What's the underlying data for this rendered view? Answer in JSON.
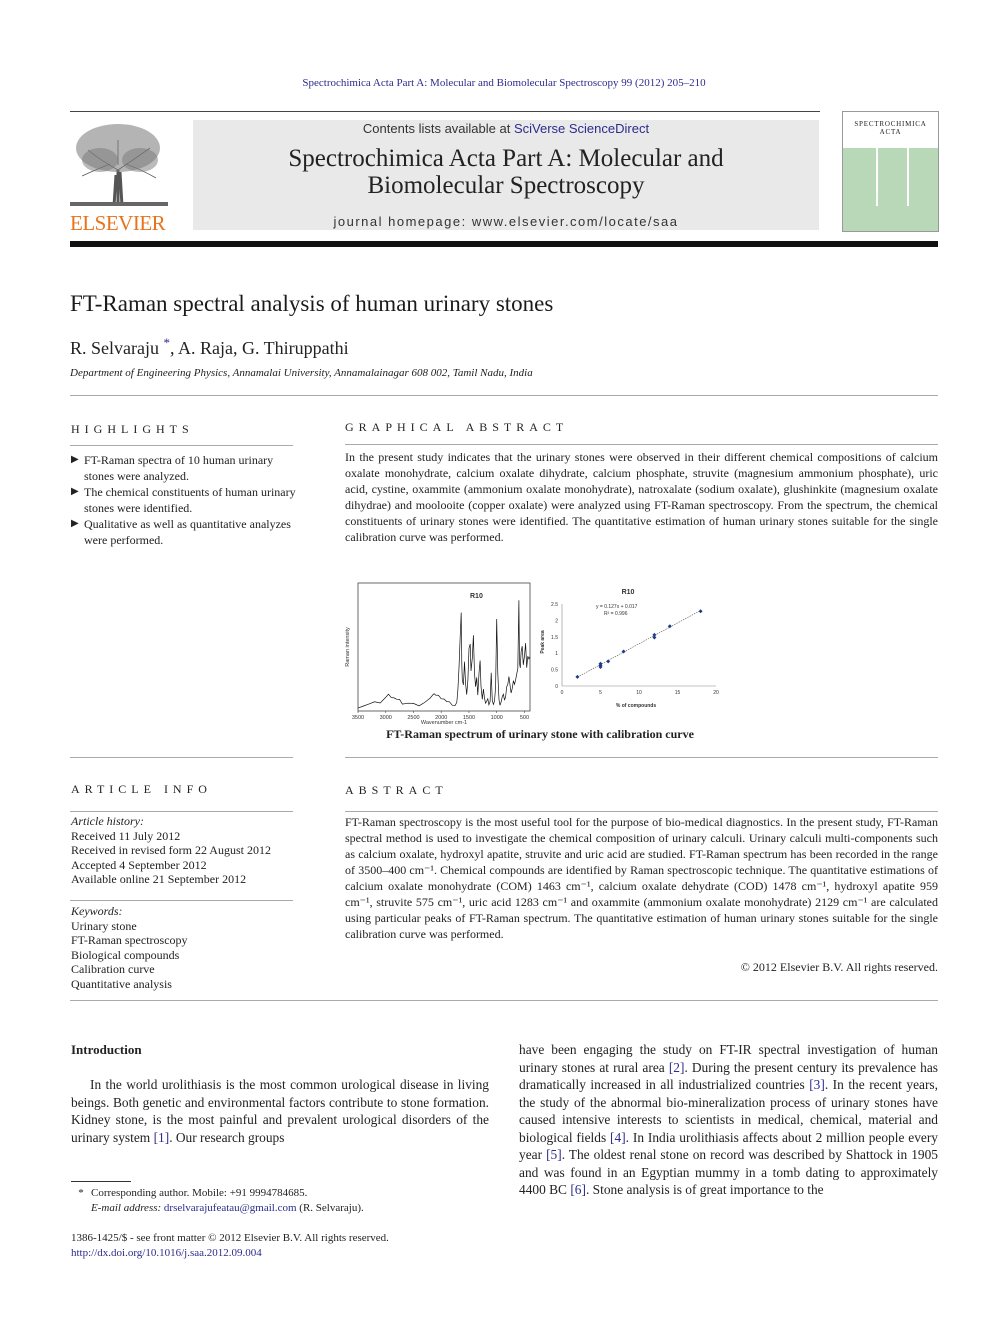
{
  "running_head": "Spectrochimica Acta Part A: Molecular and Biomolecular Spectroscopy 99 (2012) 205–210",
  "header": {
    "publisher_logo_text": "ELSEVIER",
    "contents_prefix": "Contents lists available at ",
    "contents_link": "SciVerse ScienceDirect",
    "journal_title_line1": "Spectrochimica Acta Part A: Molecular and",
    "journal_title_line2": "Biomolecular Spectroscopy",
    "homepage_label": "journal homepage: ",
    "homepage_url": "www.elsevier.com/locate/saa",
    "cover_title_line1": "SPECTROCHIMICA",
    "cover_title_line2": "ACTA"
  },
  "article": {
    "title": "FT-Raman spectral analysis of human urinary stones",
    "authors": [
      {
        "name": "R. Selvaraju",
        "mark": "*"
      },
      {
        "name": "A. Raja"
      },
      {
        "name": "G. Thiruppathi"
      }
    ],
    "author_sep1": ", ",
    "author_sep2": ", ",
    "affiliation": "Department of Engineering Physics, Annamalai University, Annamalainagar 608 002, Tamil Nadu, India"
  },
  "highlights": {
    "heading": "HIGHLIGHTS",
    "items": [
      "FT-Raman spectra of 10 human urinary stones were analyzed.",
      "The chemical constituents of human urinary stones were identified.",
      "Qualitative as well as quantitative analyzes were performed."
    ]
  },
  "graphical_abstract": {
    "heading": "GRAPHICAL ABSTRACT",
    "text": "In the present study indicates that the urinary stones were observed in their different chemical compositions of calcium oxalate monohydrate, calcium oxalate dihydrate, calcium phosphate, struvite (magnesium ammonium phosphate), uric acid, cystine, oxammite (ammonium oxalate monohydrate), natroxalate (sodium oxalate), glushinkite (magnesium oxalate dihydrae) and moolooite (copper oxalate) were analyzed using FT-Raman spectroscopy. From the spectrum, the chemical constituents of urinary stones were identified. The quantitative estimation of human urinary stones suitable for the single calibration curve was performed.",
    "caption": "FT-Raman spectrum of urinary stone with calibration curve"
  },
  "chart_data": [
    {
      "type": "line",
      "title": "R10",
      "xlabel": "Wavenumber cm-1",
      "ylabel": "Raman intensity",
      "xlim": [
        3500,
        400
      ],
      "x_ticks": [
        "3500",
        "3000",
        "2500",
        "2000",
        "1500",
        "1000",
        "500"
      ],
      "x_tick_values": [
        3500,
        3000,
        2500,
        2000,
        1500,
        1000,
        500
      ],
      "y_ticks": [],
      "grid": false,
      "series": [
        {
          "name": "spectrum",
          "x": [
            3500,
            3400,
            3300,
            3200,
            3100,
            3000,
            2950,
            2900,
            2850,
            2800,
            2750,
            2700,
            2600,
            2500,
            2400,
            2300,
            2200,
            2150,
            2129,
            2100,
            2050,
            2000,
            1950,
            1900,
            1850,
            1800,
            1750,
            1720,
            1700,
            1680,
            1660,
            1640,
            1630,
            1620,
            1600,
            1580,
            1560,
            1540,
            1520,
            1500,
            1478,
            1463,
            1440,
            1420,
            1400,
            1380,
            1360,
            1340,
            1320,
            1300,
            1283,
            1260,
            1240,
            1220,
            1200,
            1180,
            1160,
            1140,
            1120,
            1100,
            1080,
            1060,
            1040,
            1020,
            1000,
            980,
            959,
            940,
            920,
            900,
            880,
            860,
            840,
            820,
            800,
            780,
            760,
            740,
            720,
            700,
            680,
            660,
            640,
            620,
            600,
            590,
            575,
            560,
            540,
            520,
            500,
            480,
            460,
            440,
            420,
            400
          ],
          "y": [
            0.02,
            0.03,
            0.04,
            0.05,
            0.06,
            0.1,
            0.12,
            0.11,
            0.1,
            0.08,
            0.07,
            0.05,
            0.05,
            0.04,
            0.04,
            0.06,
            0.09,
            0.11,
            0.14,
            0.12,
            0.11,
            0.1,
            0.09,
            0.06,
            0.05,
            0.04,
            0.03,
            0.05,
            0.18,
            0.36,
            0.6,
            0.82,
            0.4,
            0.25,
            0.2,
            0.42,
            0.22,
            0.12,
            0.24,
            0.53,
            0.56,
            0.32,
            0.45,
            0.64,
            0.3,
            0.18,
            0.28,
            0.12,
            0.3,
            0.43,
            0.2,
            0.08,
            0.16,
            0.1,
            0.05,
            0.06,
            0.1,
            0.04,
            0.06,
            0.3,
            0.08,
            0.04,
            0.06,
            0.2,
            0.78,
            0.3,
            0.07,
            0.04,
            0.06,
            0.1,
            0.14,
            0.08,
            0.1,
            0.18,
            0.22,
            0.28,
            0.2,
            0.15,
            0.18,
            0.24,
            0.2,
            0.26,
            0.3,
            0.34,
            0.95,
            0.4,
            0.35,
            0.48,
            0.55,
            0.38,
            0.45,
            0.58,
            0.36,
            0.45,
            0.42,
            0.46
          ]
        }
      ]
    },
    {
      "type": "scatter",
      "title": "R10",
      "xlabel": "% of compounds",
      "ylabel": "Peak area",
      "xlim": [
        0,
        20
      ],
      "ylim": [
        0,
        2.5
      ],
      "x_ticks": [
        "0",
        "5",
        "10",
        "15",
        "20"
      ],
      "x_tick_values": [
        0,
        5,
        10,
        15,
        20
      ],
      "y_ticks": [
        "0",
        "0.5",
        "1",
        "1.5",
        "2",
        "2.5"
      ],
      "y_tick_values": [
        0,
        0.5,
        1,
        1.5,
        2,
        2.5
      ],
      "grid": false,
      "annotation_line1": "y = 0.127x + 0.017",
      "annotation_line2": "R² = 0.996",
      "fit": {
        "slope": 0.127,
        "intercept": 0.017
      },
      "series": [
        {
          "name": "samples",
          "x": [
            2,
            5,
            5,
            5,
            6,
            8,
            12,
            12,
            14,
            18
          ],
          "y": [
            0.28,
            0.58,
            0.63,
            0.68,
            0.75,
            1.05,
            1.48,
            1.56,
            1.82,
            2.28
          ]
        }
      ]
    }
  ],
  "article_info": {
    "heading": "ARTICLE INFO",
    "history_label": "Article history:",
    "history": [
      "Received 11 July 2012",
      "Received in revised form 22 August 2012",
      "Accepted 4 September 2012",
      "Available online 21 September 2012"
    ],
    "keywords_label": "Keywords:",
    "keywords": [
      "Urinary stone",
      "FT-Raman spectroscopy",
      "Biological compounds",
      "Calibration curve",
      "Quantitative analysis"
    ]
  },
  "abstract": {
    "heading": "ABSTRACT",
    "text": "FT-Raman spectroscopy is the most useful tool for the purpose of bio-medical diagnostics. In the present study, FT-Raman spectral method is used to investigate the chemical composition of urinary calculi. Urinary calculi multi-components such as calcium oxalate, hydroxyl apatite, struvite and uric acid are studied. FT-Raman spectrum has been recorded in the range of 3500–400 cm⁻¹. Chemical compounds are identified by Raman spectroscopic technique. The quantitative estimations of calcium oxalate monohydrate (COM) 1463 cm⁻¹, calcium oxalate dehydrate (COD) 1478 cm⁻¹, hydroxyl apatite 959 cm⁻¹, struvite 575 cm⁻¹, uric acid 1283 cm⁻¹ and oxammite (ammonium oxalate monohydrate) 2129 cm⁻¹ are calculated using particular peaks of FT-Raman spectrum. The quantitative estimation of human urinary stones suitable for the single calibration curve was performed.",
    "copyright": "© 2012 Elsevier B.V. All rights reserved."
  },
  "introduction": {
    "heading": "Introduction",
    "col1_p1_a": "In the world urolithiasis is the most common urological disease in living beings. Both genetic and environmental factors contribute to stone formation. Kidney stone, is the most painful and prevalent urological disorders of the urinary system ",
    "ref1": "[1]",
    "col1_p1_b": ". Our research groups",
    "col2_a": "have been engaging the study on FT-IR spectral investigation of human urinary stones at rural area ",
    "ref2": "[2]",
    "col2_b": ". During the present century its prevalence has dramatically increased in all industrialized countries ",
    "ref3": "[3]",
    "col2_c": ". In the recent years, the study of the abnormal bio-mineralization process of urinary stones have caused intensive interests to scientists in medical, chemical, material and biological fields ",
    "ref4": "[4]",
    "col2_d": ". In India urolithiasis affects about 2 million people every year ",
    "ref5": "[5]",
    "col2_e": ". The oldest renal stone on record was described by Shattock in 1905 and was found in an Egyptian mummy in a tomb dating to approximately 4400 BC ",
    "ref6": "[6]",
    "col2_f": ". Stone analysis is of great importance to the"
  },
  "footnotes": {
    "mark": "*",
    "corresponding": "Corresponding author. Mobile: +91 9994784685.",
    "email_label": "E-mail address: ",
    "email": "drselvarajufeatau@gmail.com",
    "email_suffix": " (R. Selvaraju).",
    "front_matter": "1386-1425/$ - see front matter © 2012 Elsevier B.V. All rights reserved.",
    "doi": "http://dx.doi.org/10.1016/j.saa.2012.09.004"
  }
}
